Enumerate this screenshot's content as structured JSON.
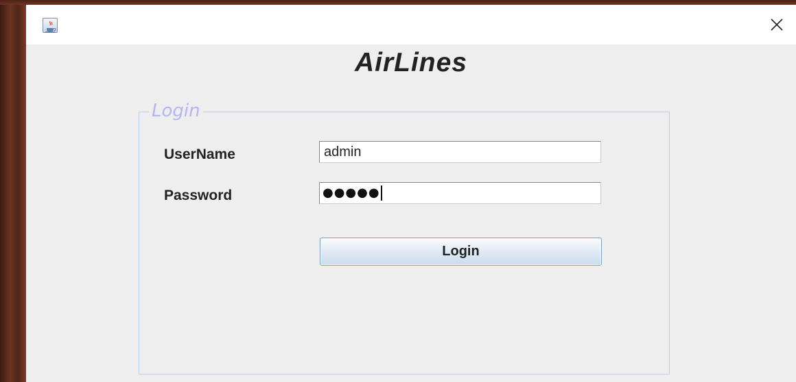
{
  "window": {
    "close_icon": "close-icon",
    "app_icon": "java-cup-icon"
  },
  "app": {
    "title": "AirLines"
  },
  "login_panel": {
    "legend": "Login",
    "username_label": "UserName",
    "username_value": "admin",
    "password_label": "Password",
    "password_masked": "●●●●●",
    "button_label": "Login"
  },
  "colors": {
    "window_bg": "#eeeeee",
    "titlebar_bg": "#ffffff",
    "legend_color": "#b6b6ee",
    "fieldset_border": "#b8cfe4",
    "button_top": "#fbfcfe",
    "button_bottom": "#c9dcee"
  }
}
